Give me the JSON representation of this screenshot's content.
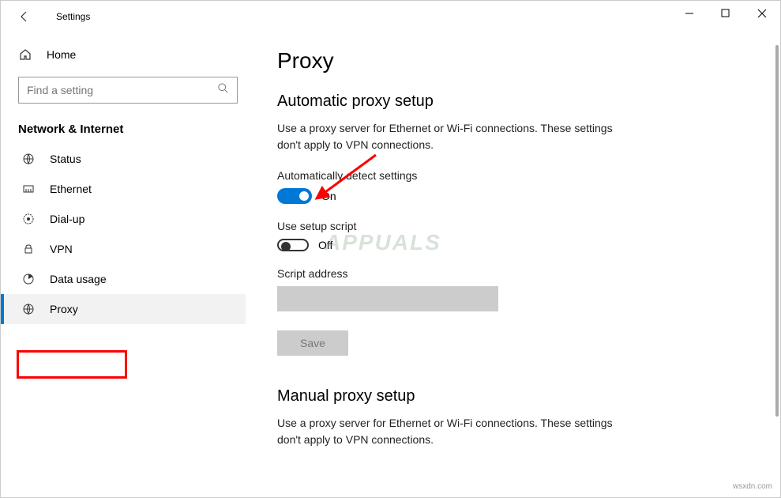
{
  "titlebar": {
    "title": "Settings"
  },
  "sidebar": {
    "home_label": "Home",
    "search_placeholder": "Find a setting",
    "group_header": "Network & Internet",
    "items": [
      {
        "label": "Status"
      },
      {
        "label": "Ethernet"
      },
      {
        "label": "Dial-up"
      },
      {
        "label": "VPN"
      },
      {
        "label": "Data usage"
      },
      {
        "label": "Proxy"
      }
    ]
  },
  "main": {
    "page_title": "Proxy",
    "auto_section_title": "Automatic proxy setup",
    "auto_desc": "Use a proxy server for Ethernet or Wi-Fi connections. These settings don't apply to VPN connections.",
    "auto_detect_label": "Automatically detect settings",
    "auto_detect_state": "On",
    "setup_script_label": "Use setup script",
    "setup_script_state": "Off",
    "script_address_label": "Script address",
    "save_label": "Save",
    "manual_section_title": "Manual proxy setup",
    "manual_desc": "Use a proxy server for Ethernet or Wi-Fi connections. These settings don't apply to VPN connections."
  },
  "watermark_center": "APPUALS",
  "watermark_corner": "wsxdn.com"
}
